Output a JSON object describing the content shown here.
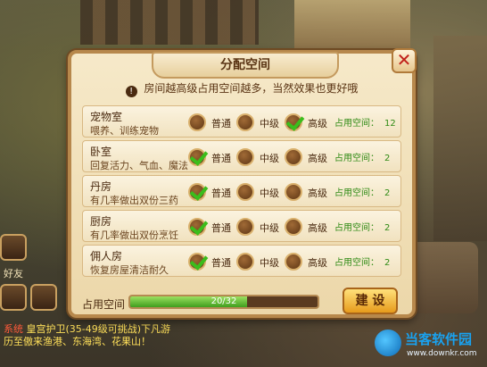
{
  "dialog": {
    "title": "分配空间",
    "close_glyph": "✕",
    "hint": "房间越高级占用空间越多，当然效果也更好哦",
    "hint_icon_glyph": "!",
    "levels": [
      "普通",
      "中级",
      "高级"
    ],
    "occupancy_label": "占用空间：",
    "rooms": [
      {
        "name": "宠物室",
        "desc": "喂养、训练宠物",
        "selected": "高级",
        "occupancy": "12"
      },
      {
        "name": "卧室",
        "desc": "回复活力、气血、魔法",
        "selected": "普通",
        "occupancy": "2"
      },
      {
        "name": "丹房",
        "desc": "有几率做出双份三药",
        "selected": "普通",
        "occupancy": "2"
      },
      {
        "name": "厨房",
        "desc": "有几率做出双份烹饪",
        "selected": "普通",
        "occupancy": "2"
      },
      {
        "name": "佣人房",
        "desc": "恢复房屋清洁耐久",
        "selected": "普通",
        "occupancy": "2"
      }
    ],
    "space_label": "占用空间",
    "progress_text": "20/32",
    "progress_fraction": 0.625,
    "build_label": "建 设"
  },
  "hud": {
    "friend_label": "好友",
    "chat_line1_tag": "系统",
    "chat_line1": "皇宫护卫(35-49级可挑战)下凡游",
    "chat_line2": "历至傲来渔港、东海湾、花果山！"
  },
  "watermark": {
    "brand": "当客软件园",
    "url": "www.downkr.com"
  },
  "colors": {
    "occupancy_green": "#2f8a14",
    "check_green": "#3bbd1c",
    "close_red": "#c0201a",
    "build_orange": "#e79b1c"
  }
}
